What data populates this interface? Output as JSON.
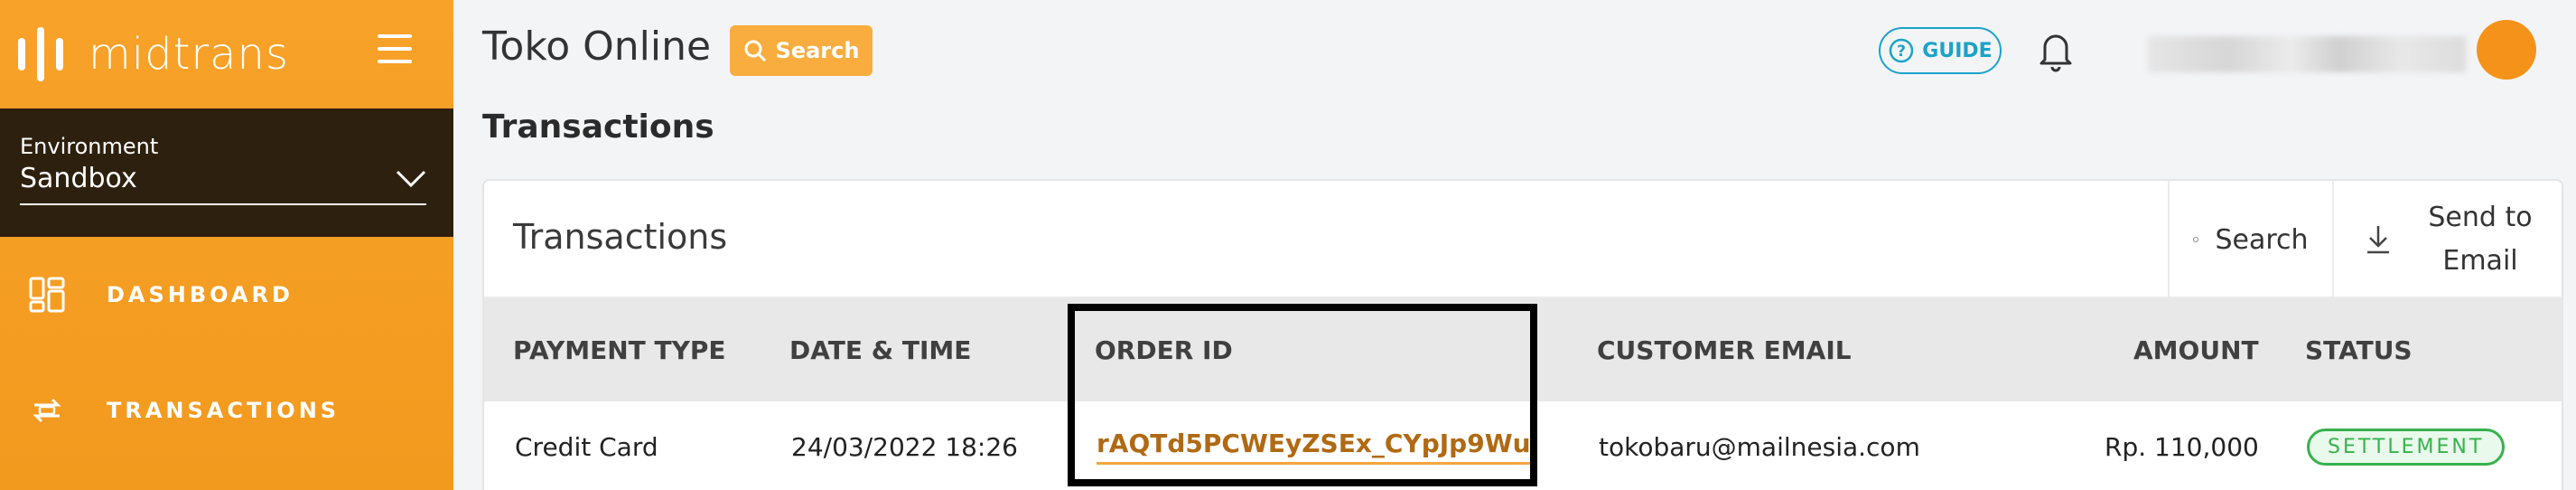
{
  "colors": {
    "sidebar_bg": "#f8a22a",
    "env_bg": "#2e200f",
    "accent": "#f8ad3e",
    "guide": "#1aa3c8",
    "status_settlement": "#37b24d",
    "avatar": "#f4921a"
  },
  "sidebar": {
    "brand": "midtrans",
    "menu_icon": "hamburger-icon",
    "environment": {
      "label": "Environment",
      "value": "Sandbox",
      "icon": "chevron-down-icon"
    },
    "items": [
      {
        "label": "DASHBOARD",
        "icon": "dashboard-icon"
      },
      {
        "label": "TRANSACTIONS",
        "icon": "transactions-icon"
      }
    ]
  },
  "header": {
    "store_name": "Toko Online",
    "search_label": "Search",
    "guide_label": "GUIDE",
    "bell_icon": "bell-icon"
  },
  "page": {
    "title": "Transactions"
  },
  "card": {
    "title": "Transactions",
    "search_label": "Search",
    "send_email_line1": "Send to",
    "send_email_line2": "Email"
  },
  "table": {
    "columns": [
      "PAYMENT TYPE",
      "DATE & TIME",
      "ORDER ID",
      "CUSTOMER EMAIL",
      "AMOUNT",
      "STATUS"
    ],
    "rows": [
      {
        "payment_type": "Credit Card",
        "datetime": "24/03/2022 18:26",
        "order_id": "rAQTd5PCWEyZSEx_CYpJp9Wu",
        "email": "tokobaru@mailnesia.com",
        "amount": "Rp. 110,000",
        "status": "SETTLEMENT"
      }
    ]
  }
}
